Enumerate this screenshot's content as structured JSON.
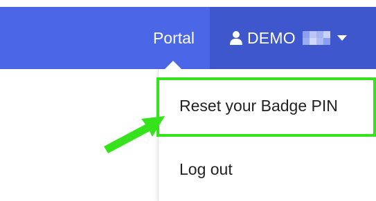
{
  "navbar": {
    "portal_label": "Portal",
    "user": {
      "icon": "user-icon",
      "name": "DEMO",
      "pixelated_colors": [
        "#8da0f0",
        "#b9c5f7",
        "#a4b3f3",
        "#c6d0f8",
        "#9cadf2",
        "#d1d9fa",
        "#aebcf5",
        "#8b9ff0"
      ],
      "dropdown_icon": "caret-down-icon"
    },
    "colors": {
      "bar": "#4b67e8",
      "user_bg": "#3f57cc",
      "text": "#ffffff"
    }
  },
  "dropdown": {
    "items": [
      {
        "label": "Reset your Badge PIN",
        "highlighted": true
      },
      {
        "label": "Log out",
        "highlighted": false
      }
    ]
  },
  "annotation": {
    "highlight_color": "#35e21c",
    "arrow_icon": "arrow-icon"
  }
}
